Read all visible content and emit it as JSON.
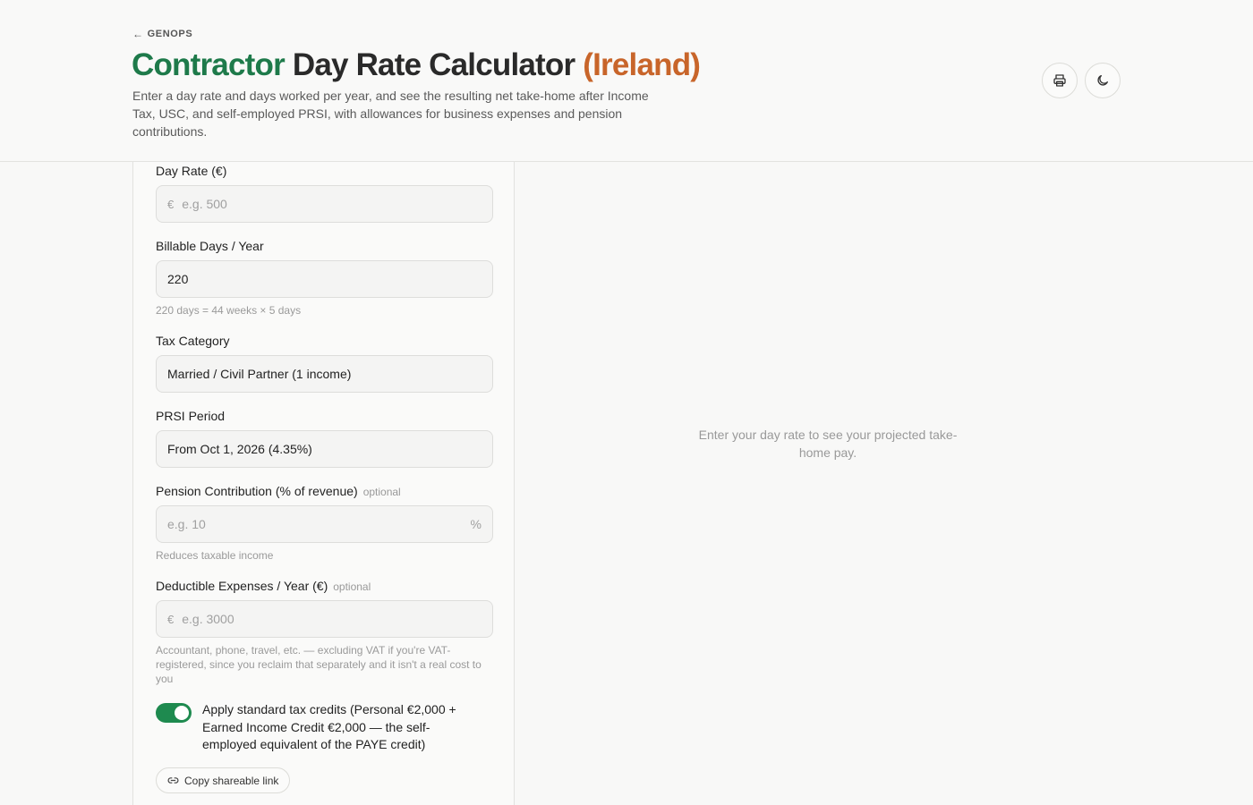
{
  "header": {
    "back_label": "GENOPS",
    "title_part1": "Contractor",
    "title_part2": "Day Rate Calculator",
    "title_part3": "(Ireland)",
    "subtitle": "Enter a day rate and days worked per year, and see the resulting net take-home after Income Tax, USC, and self-employed PRSI, with allowances for business expenses and pension contributions."
  },
  "form": {
    "day_rate": {
      "label": "Day Rate (€)",
      "prefix": "€",
      "placeholder": "e.g. 500"
    },
    "billable_days": {
      "label": "Billable Days / Year",
      "value": "220",
      "hint": "220 days = 44 weeks × 5 days"
    },
    "tax_category": {
      "label": "Tax Category",
      "value": "Married / Civil Partner (1 income)"
    },
    "prsi_period": {
      "label": "PRSI Period",
      "value": "From Oct 1, 2026 (4.35%)"
    },
    "pension": {
      "label": "Pension Contribution (% of revenue)",
      "optional": "optional",
      "placeholder": "e.g. 10",
      "suffix": "%",
      "hint": "Reduces taxable income"
    },
    "expenses": {
      "label": "Deductible Expenses / Year (€)",
      "optional": "optional",
      "prefix": "€",
      "placeholder": "e.g. 3000",
      "hint": "Accountant, phone, travel, etc. — excluding VAT if you're VAT-registered, since you reclaim that separately and it isn't a real cost to you"
    },
    "credits_toggle": {
      "label": "Apply standard tax credits (Personal €2,000 + Earned Income Credit €2,000 — the self-employed equivalent of the PAYE credit)",
      "on": true
    },
    "share_label": "Copy shareable link"
  },
  "results": {
    "empty_message": "Enter your day rate to see your projected take-home pay."
  },
  "colors": {
    "accent_green": "#1e7a4a",
    "accent_orange": "#c8652a",
    "toggle_on": "#1e8a4f"
  },
  "icons": {
    "print": "printer-icon",
    "theme": "moon-icon",
    "share": "link-icon",
    "back": "arrow-left-icon"
  }
}
